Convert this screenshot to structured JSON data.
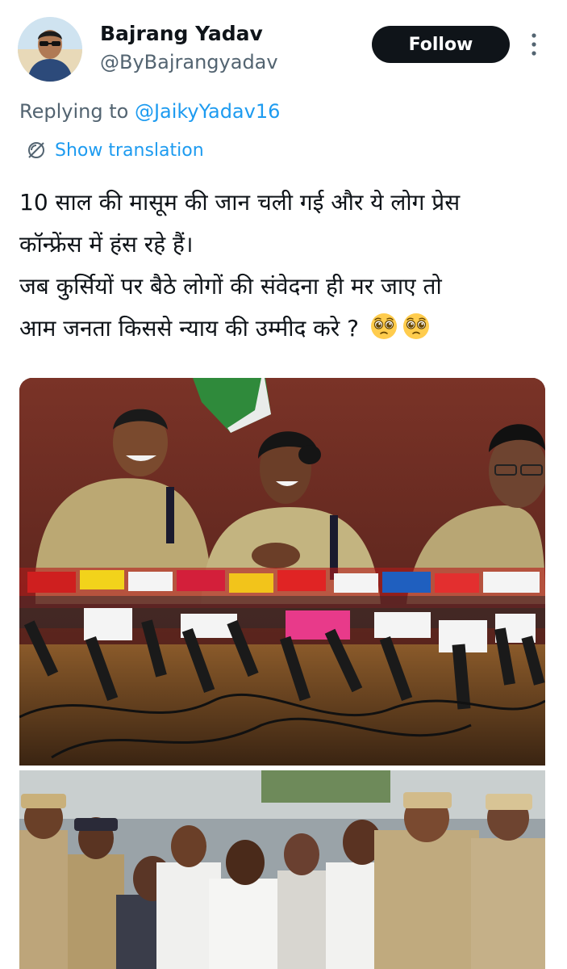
{
  "author": {
    "name": "Bajrang Yadav",
    "handle": "@ByBajrangyadav"
  },
  "follow_label": "Follow",
  "reply": {
    "prefix": "Replying to ",
    "mention": "@JaikyYadav16"
  },
  "translation_label": "Show translation",
  "tweet": {
    "line1": "10 साल की मासूम की जान चली गई और ये लोग प्रेस",
    "line2": "कॉन्फ्रेंस में हंस रहे हैं।",
    "line3": "जब कुर्सियों पर बैठे लोगों की संवेदना ही मर जाए तो",
    "line4": "आम जनता किससे न्याय की उम्मीद करे ?"
  },
  "colors": {
    "accent": "#1d9bf0",
    "text": "#0f1419",
    "secondary": "#536471",
    "follow_bg": "#0f1419"
  }
}
